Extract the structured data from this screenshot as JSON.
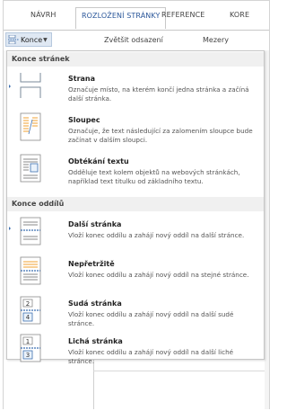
{
  "ribbon": {
    "tabs": [
      {
        "label": "NÁVRH",
        "active": false
      },
      {
        "label": "ROZLOŽENÍ STRÁNKY",
        "active": true
      },
      {
        "label": "REFERENCE",
        "active": false
      },
      {
        "label": "KORE",
        "active": false
      }
    ],
    "konce_label": "Konce",
    "zvetsit_label": "Zvětšit odsazení",
    "mezery_label": "Mezery"
  },
  "menu": {
    "sections": [
      {
        "heading": "Konce stránek",
        "items": [
          {
            "title": "Strana",
            "desc": "Označuje místo, na kterém končí jedna stránka a začíná další stránka.",
            "icon": "page-break-icon"
          },
          {
            "title": "Sloupec",
            "desc": "Označuje, že text následující za zalomením sloupce bude začínat v dalším sloupci.",
            "icon": "column-break-icon"
          },
          {
            "title": "Obtékání textu",
            "desc": "Odděluje text kolem objektů na webových stránkách, například text titulku od základního textu.",
            "icon": "text-wrapping-icon"
          }
        ]
      },
      {
        "heading": "Konce oddílů",
        "items": [
          {
            "title": "Další stránka",
            "desc": "Vloží konec oddílu a zahájí nový oddíl na další stránce.",
            "icon": "next-page-section-icon"
          },
          {
            "title": "Nepřetržitě",
            "desc": "Vloží konec oddílu a zahájí nový oddíl na stejné stránce.",
            "icon": "continuous-section-icon"
          },
          {
            "title": "Sudá stránka",
            "desc": "Vloží konec oddílu a zahájí nový oddíl na další sudé stránce.",
            "icon": "even-page-section-icon",
            "icon_number": "2"
          },
          {
            "title": "Lichá stránka",
            "desc": "Vloží konec oddílu a zahájí nový oddíl na další liché stránce.",
            "icon": "odd-page-section-icon",
            "icon_number": "1"
          }
        ]
      }
    ]
  },
  "colors": {
    "accent": "#2b579a",
    "button_bg": "#dfe8f3",
    "section_bg": "#f0f0f0"
  }
}
